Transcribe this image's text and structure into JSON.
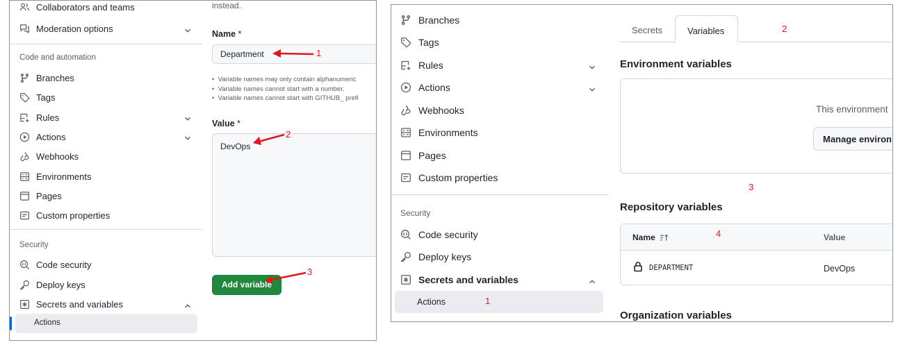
{
  "left_panel": {
    "sidebar": {
      "items_top": [
        {
          "label": "Collaborators and teams",
          "icon": "people-icon"
        },
        {
          "label": "Moderation options",
          "icon": "comment-discussion-icon"
        }
      ],
      "section_code": "Code and automation",
      "items_code": [
        {
          "label": "Branches",
          "icon": "branch-icon"
        },
        {
          "label": "Tags",
          "icon": "tag-icon"
        },
        {
          "label": "Rules",
          "icon": "rules-icon"
        },
        {
          "label": "Actions",
          "icon": "play-icon"
        },
        {
          "label": "Webhooks",
          "icon": "webhook-icon"
        },
        {
          "label": "Environments",
          "icon": "server-icon"
        },
        {
          "label": "Pages",
          "icon": "browser-icon"
        },
        {
          "label": "Custom properties",
          "icon": "note-icon"
        }
      ],
      "section_security": "Security",
      "items_security": [
        {
          "label": "Code security",
          "icon": "codescan-icon"
        },
        {
          "label": "Deploy keys",
          "icon": "key-icon"
        },
        {
          "label": "Secrets and variables",
          "icon": "asterisk-icon"
        }
      ],
      "sub_item": "Actions"
    },
    "form": {
      "instead_text": "instead.",
      "name_label": "Name",
      "required_mark": "*",
      "name_value": "Department",
      "hints": [
        "Variable names may only contain alphanumeric",
        "Variable names cannot start with a number.",
        "Variable names cannot start with GITHUB_ prefi"
      ],
      "value_label": "Value",
      "value_text": "DevOps",
      "add_button": "Add variable"
    },
    "annotations": [
      "1",
      "2",
      "3"
    ]
  },
  "right_panel": {
    "sidebar": {
      "items": [
        {
          "label": "Branches",
          "icon": "branch-icon"
        },
        {
          "label": "Tags",
          "icon": "tag-icon"
        },
        {
          "label": "Rules",
          "icon": "rules-icon"
        },
        {
          "label": "Actions",
          "icon": "play-icon"
        },
        {
          "label": "Webhooks",
          "icon": "webhook-icon"
        },
        {
          "label": "Environments",
          "icon": "server-icon"
        },
        {
          "label": "Pages",
          "icon": "browser-icon"
        },
        {
          "label": "Custom properties",
          "icon": "note-icon"
        }
      ],
      "section_security": "Security",
      "items_security": [
        {
          "label": "Code security",
          "icon": "codescan-icon"
        },
        {
          "label": "Deploy keys",
          "icon": "key-icon"
        },
        {
          "label": "Secrets and variables",
          "icon": "asterisk-icon"
        }
      ],
      "sub_item": "Actions"
    },
    "tabs": [
      "Secrets",
      "Variables"
    ],
    "env_heading": "Environment variables",
    "env_text": "This environment",
    "env_button": "Manage environ",
    "repo_heading": "Repository variables",
    "table": {
      "col_name": "Name",
      "col_value": "Value",
      "rows": [
        {
          "name": "DEPARTMENT",
          "value": "DevOps"
        }
      ]
    },
    "org_heading": "Organization variables",
    "annotations": [
      "1",
      "2",
      "3",
      "4"
    ]
  },
  "colors": {
    "accent": "#0969da",
    "button_green": "#1f883d",
    "annotation_red": "#e5141b",
    "selected_bg": "#eaecef"
  }
}
